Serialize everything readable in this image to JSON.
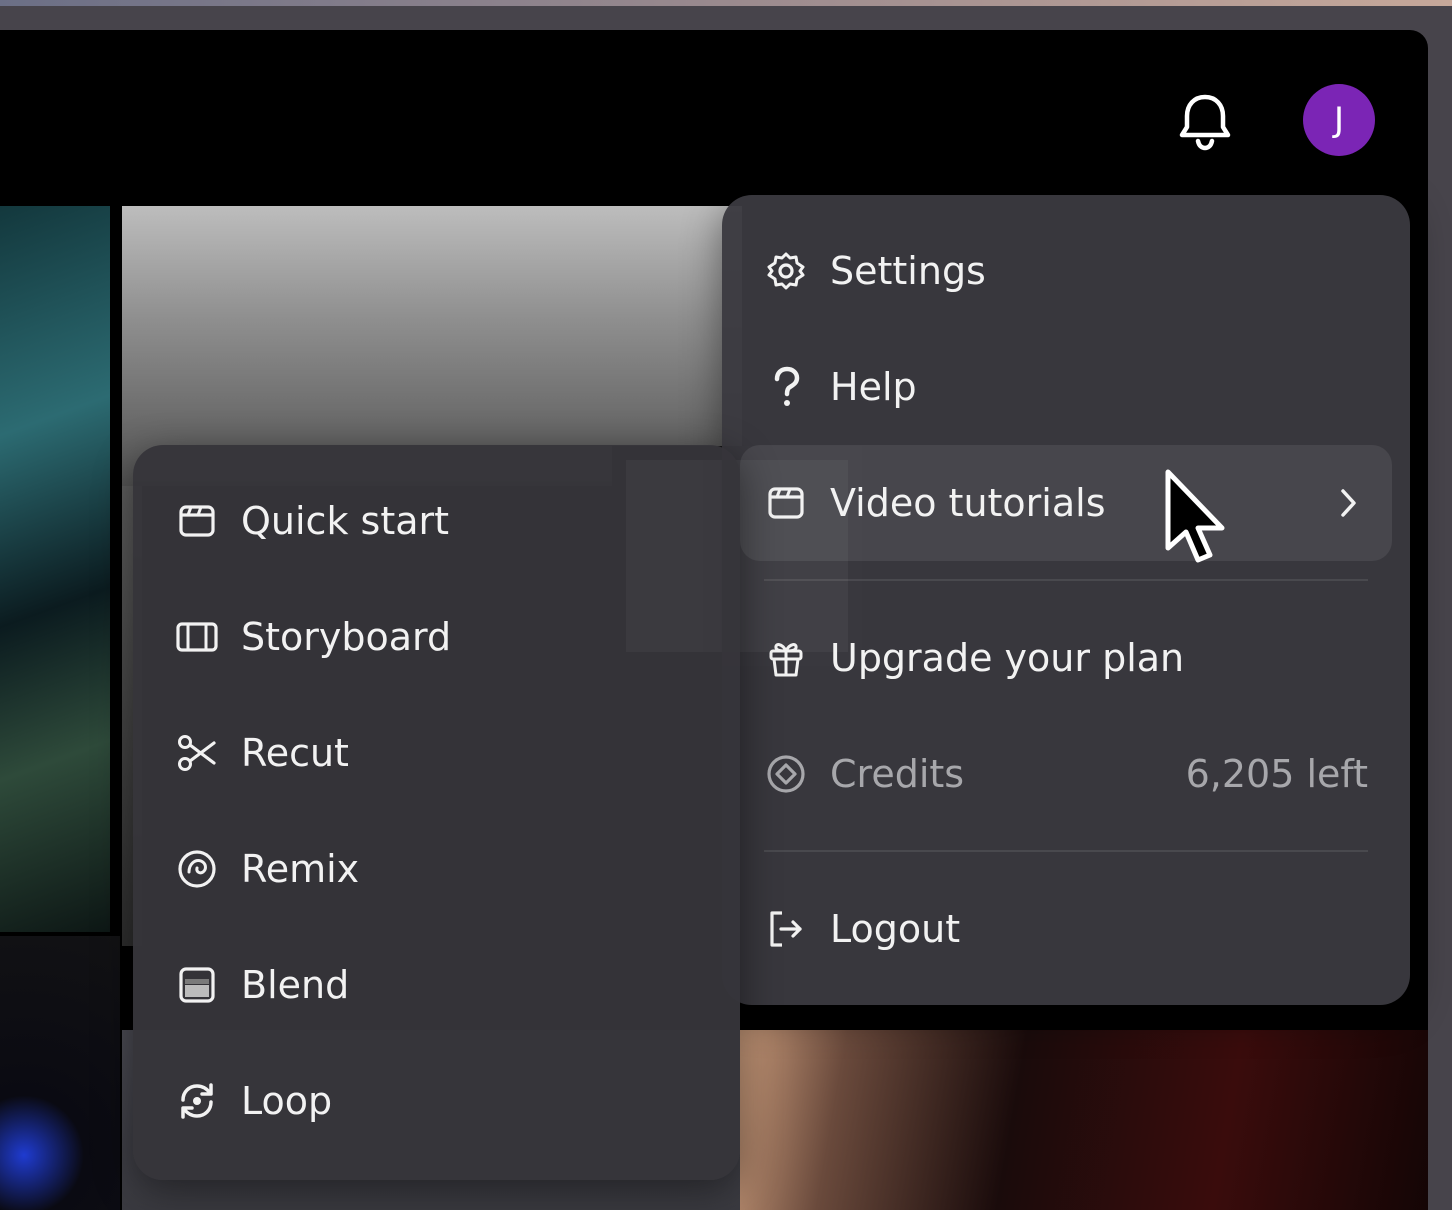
{
  "header": {
    "avatar_initial": "J",
    "avatar_color": "#7b25b5",
    "notification_icon": "bell-icon"
  },
  "account_menu": {
    "items": [
      {
        "label": "Settings",
        "icon": "gear-icon"
      },
      {
        "label": "Help",
        "icon": "question-icon"
      },
      {
        "label": "Video tutorials",
        "icon": "clapperboard-icon",
        "has_submenu": true,
        "hovered": true
      },
      {
        "label": "Upgrade your plan",
        "icon": "gift-icon"
      },
      {
        "label": "Credits",
        "icon": "credits-icon",
        "value": "6,205 left",
        "disabled": true
      },
      {
        "label": "Logout",
        "icon": "logout-icon"
      }
    ]
  },
  "tutorials_menu": {
    "items": [
      {
        "label": "Quick start",
        "icon": "clapperboard-icon"
      },
      {
        "label": "Storyboard",
        "icon": "storyboard-icon"
      },
      {
        "label": "Recut",
        "icon": "scissors-icon"
      },
      {
        "label": "Remix",
        "icon": "remix-icon"
      },
      {
        "label": "Blend",
        "icon": "blend-icon"
      },
      {
        "label": "Loop",
        "icon": "loop-icon"
      }
    ]
  }
}
